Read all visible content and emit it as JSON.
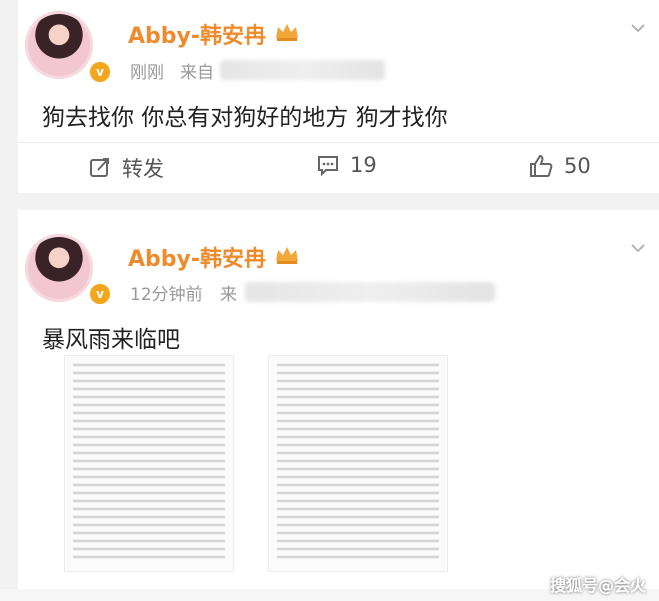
{
  "post1": {
    "author": "Abby-韩安冉",
    "time_prefix": "刚刚",
    "source_prefix": "来自",
    "text": "狗去找你 你总有对狗好的地方 狗才找你",
    "actions": {
      "repost_label": "转发",
      "comment_count": "19",
      "like_count": "50"
    }
  },
  "post2": {
    "author": "Abby-韩安冉",
    "time_prefix": "12分钟前",
    "source_prefix": "来",
    "text": "暴风雨来临吧"
  },
  "watermark": "搜狐号@会火",
  "colors": {
    "author_name": "#ee8b2d",
    "verified_badge": "#f3a51b",
    "background": "#f2f2f2",
    "card": "#ffffff"
  },
  "icons": [
    "crown-icon",
    "chevron-down-icon",
    "repost-icon",
    "comment-icon",
    "like-icon",
    "verified-badge-icon"
  ]
}
